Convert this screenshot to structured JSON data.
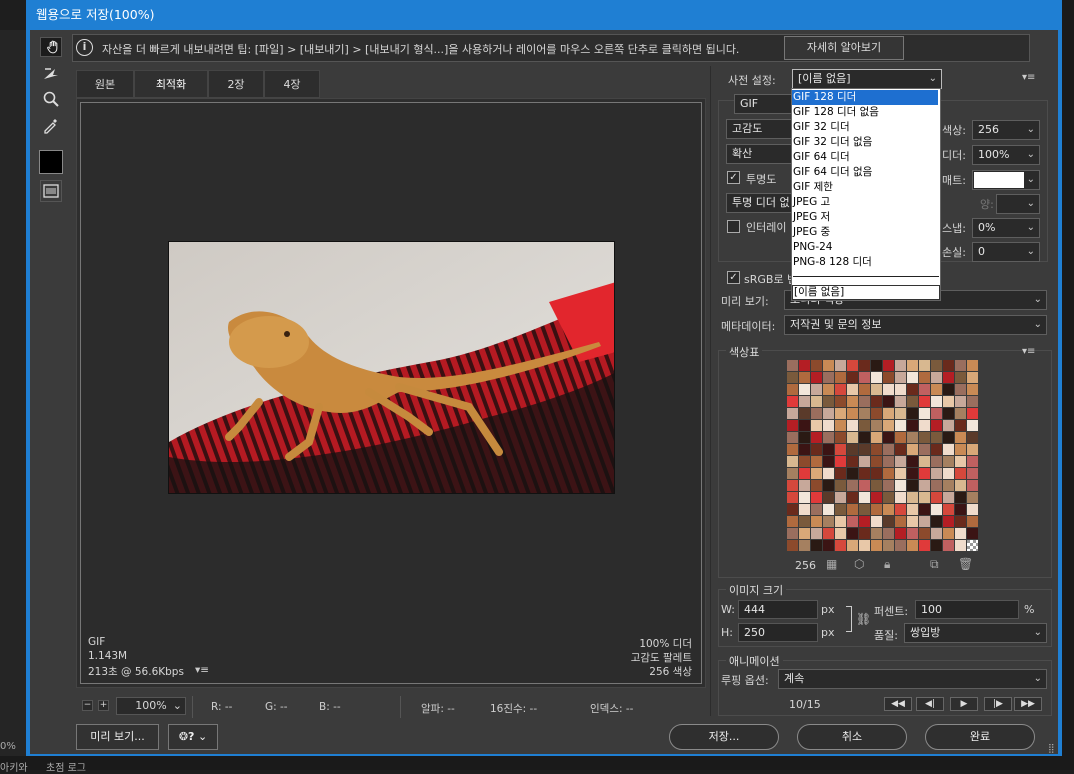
{
  "window": {
    "title": "웹용으로 저장(100%)"
  },
  "tip": {
    "text": "자산을 더 빠르게 내보내려면 팁: [파일] > [내보내기] > [내보내기 형식...]을 사용하거나 레이어를 마우스 오른쪽 단추로 클릭하면 됩니다.",
    "learn_more": "자세히 알아보기"
  },
  "tools": [
    {
      "name": "hand-tool",
      "icon": "hand-icon"
    },
    {
      "name": "slice-select-tool",
      "icon": "slice-select-icon"
    },
    {
      "name": "zoom-tool",
      "icon": "zoom-icon"
    },
    {
      "name": "eyedropper-tool",
      "icon": "eyedropper-icon"
    },
    {
      "name": "eyedropper-color",
      "icon": "color-swatch-icon",
      "color": "#000000"
    },
    {
      "name": "toggle-slices",
      "icon": "slices-visibility-icon"
    }
  ],
  "tabs": [
    "원본",
    "최적화",
    "2장",
    "4장"
  ],
  "active_tab": "최적화",
  "image_info": {
    "format": "GIF",
    "size": "1.143M",
    "time": "213초 @ 56.6Kbps",
    "dither": "100% 디더",
    "palette": "고감도 팔레트",
    "colors": "256 색상"
  },
  "status": {
    "zoom": "100%",
    "r": "R: --",
    "g": "G: --",
    "b": "B: --",
    "alpha": "알파: --",
    "hex": "16진수: --",
    "index": "인덱스: --"
  },
  "buttons": {
    "preview": "미리 보기...",
    "save": "저장...",
    "cancel": "취소",
    "done": "완료"
  },
  "settings": {
    "preset_label": "사전 설정:",
    "preset_value": "[이름 없음]",
    "format": "GIF",
    "reduction": "고감도",
    "dither_algo": "확산",
    "transparency_label": "투명도",
    "transparency_checked": true,
    "matte_dither": "투명 디더 없",
    "interlace_label": "인터레이",
    "interlace_checked": false,
    "colors_label": "색상:",
    "colors_value": "256",
    "dither_label": "디더:",
    "dither_value": "100%",
    "matte_label": "매트:",
    "amount_label": "양:",
    "websnap_label": "스냅:",
    "websnap_value": "0%",
    "lossy_label": "손실:",
    "lossy_value": "0",
    "srgb_label": "sRGB로 변",
    "srgb_checked": true,
    "preview_label": "미리 보기:",
    "preview_value": "모니터 색상",
    "metadata_label": "메타데이터:",
    "metadata_value": "저작권 및 문의 정보"
  },
  "preset_dropdown": {
    "items": [
      "GIF 128 디더",
      "GIF 128 디더 없음",
      "GIF 32 디더",
      "GIF 32 디더 없음",
      "GIF 64 디더",
      "GIF 64 디더 없음",
      "GIF 제한",
      "JPEG 고",
      "JPEG 저",
      "JPEG 중",
      "PNG-24",
      "PNG-8 128 디더"
    ],
    "highlighted": "GIF 128 디더",
    "current": "[이름 없음]"
  },
  "color_table": {
    "title": "색상표",
    "count": "256"
  },
  "image_size": {
    "title": "이미지 크기",
    "w_label": "W:",
    "w_value": "444",
    "h_label": "H:",
    "h_value": "250",
    "unit": "px",
    "percent_label": "퍼센트:",
    "percent_value": "100",
    "percent_unit": "%",
    "quality_label": "품질:",
    "quality_value": "쌍입방"
  },
  "animation": {
    "title": "애니메이션",
    "loop_label": "루핑 옵션:",
    "loop_value": "계속",
    "frame": "10/15"
  },
  "bottom_strip": {
    "left": "0%",
    "label_a": "아키와",
    "label_b": "초점 로그"
  }
}
